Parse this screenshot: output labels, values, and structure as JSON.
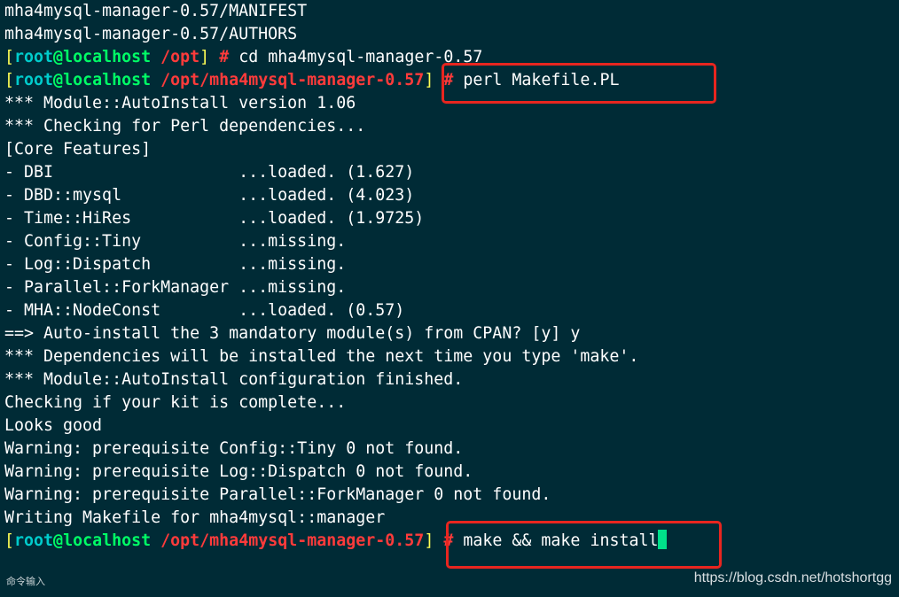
{
  "terminal": {
    "lines": [
      {
        "kind": "text",
        "text": "mha4mysql-manager-0.57/MANIFEST"
      },
      {
        "kind": "text",
        "text": "mha4mysql-manager-0.57/AUTHORS"
      },
      {
        "kind": "prompt",
        "user": "root",
        "host": "localhost",
        "path": "/opt",
        "command": "cd mha4mysql-manager-0.57"
      },
      {
        "kind": "prompt",
        "user": "root",
        "host": "localhost",
        "path": "/opt/mha4mysql-manager-0.57",
        "command": "perl Makefile.PL"
      },
      {
        "kind": "text",
        "text": "*** Module::AutoInstall version 1.06"
      },
      {
        "kind": "text",
        "text": "*** Checking for Perl dependencies..."
      },
      {
        "kind": "text",
        "text": "[Core Features]"
      },
      {
        "kind": "text",
        "text": "- DBI                   ...loaded. (1.627)"
      },
      {
        "kind": "text",
        "text": "- DBD::mysql            ...loaded. (4.023)"
      },
      {
        "kind": "text",
        "text": "- Time::HiRes           ...loaded. (1.9725)"
      },
      {
        "kind": "text",
        "text": "- Config::Tiny          ...missing."
      },
      {
        "kind": "text",
        "text": "- Log::Dispatch         ...missing."
      },
      {
        "kind": "text",
        "text": "- Parallel::ForkManager ...missing."
      },
      {
        "kind": "text",
        "text": "- MHA::NodeConst        ...loaded. (0.57)"
      },
      {
        "kind": "text",
        "text": "==> Auto-install the 3 mandatory module(s) from CPAN? [y] y"
      },
      {
        "kind": "text",
        "text": "*** Dependencies will be installed the next time you type 'make'."
      },
      {
        "kind": "text",
        "text": "*** Module::AutoInstall configuration finished."
      },
      {
        "kind": "text",
        "text": "Checking if your kit is complete..."
      },
      {
        "kind": "text",
        "text": "Looks good"
      },
      {
        "kind": "text",
        "text": "Warning: prerequisite Config::Tiny 0 not found."
      },
      {
        "kind": "text",
        "text": "Warning: prerequisite Log::Dispatch 0 not found."
      },
      {
        "kind": "text",
        "text": "Warning: prerequisite Parallel::ForkManager 0 not found."
      },
      {
        "kind": "text",
        "text": "Writing Makefile for mha4mysql::manager"
      },
      {
        "kind": "prompt",
        "user": "root",
        "host": "localhost",
        "path": "/opt/mha4mysql-manager-0.57",
        "command": "make && make install",
        "cursor": true
      }
    ]
  },
  "status_bar": {
    "label": "命令输入"
  },
  "watermark": {
    "text": "https://blog.csdn.net/hotshortgg"
  },
  "colors": {
    "background": "#002b36",
    "user": "#00cccc",
    "host": "#00ff66",
    "path": "#ff3b3b",
    "bracket": "#ffff55",
    "cursor": "#00e08a",
    "highlight": "#e8251f"
  }
}
